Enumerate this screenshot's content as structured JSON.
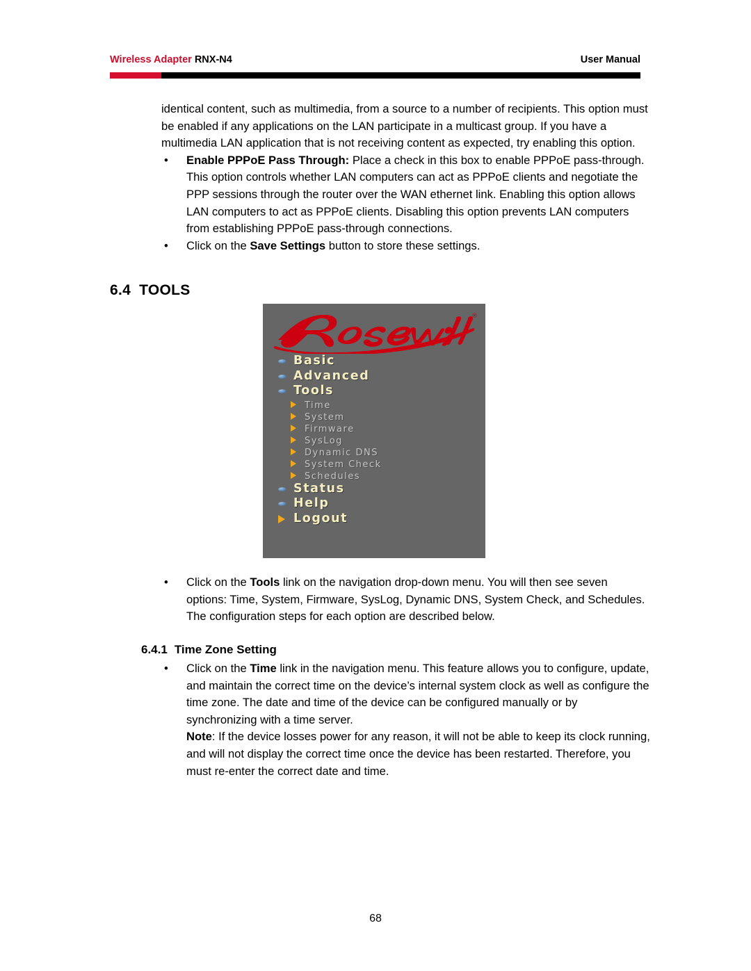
{
  "header": {
    "brand_red": "Wireless Adapter",
    "brand_model": "RNX-N4",
    "right_label": "User Manual",
    "rule_red_color": "#d70f2e",
    "rule_black_color": "#000000"
  },
  "body": {
    "intro_paragraph": "identical content, such as multimedia, from a source to a number of recipients. This option must be enabled if any applications on the LAN participate in a multicast group. If you have a multimedia LAN application that is not receiving content as expected, try enabling this option.",
    "bullet_pppoe": {
      "marker": "•",
      "bold_lead": "Enable PPPoE Pass Through:",
      "text": " Place a check in this box to enable PPPoE pass-through. This option controls whether LAN computers can act as PPPoE clients and negotiate the PPP sessions through the router over the WAN ethernet link. Enabling this option allows LAN computers to act as PPPoE clients. Disabling this option prevents LAN computers from establishing PPPoE pass-through connections."
    },
    "bullet_save": {
      "marker": "•",
      "text_before": "Click on the ",
      "bold_lead": "Save Settings",
      "text_after": " button to store these settings."
    }
  },
  "section": {
    "number": "6.4",
    "title": "TOOLS"
  },
  "router_nav": {
    "logo_text": "Rosewill",
    "logo_trademark": "®",
    "background_color": "#666666",
    "logo_color": "#cc0011",
    "main_label_color": "#f5eec2",
    "sub_label_color": "#c6c6c6",
    "arrow_color": "#f0a81e",
    "items": [
      {
        "label": "Basic",
        "level": "main",
        "marker": "dot"
      },
      {
        "label": "Advanced",
        "level": "main",
        "marker": "dot"
      },
      {
        "label": "Tools",
        "level": "main",
        "marker": "dot"
      },
      {
        "label": "Time",
        "level": "sub",
        "marker": "triangle"
      },
      {
        "label": "System",
        "level": "sub",
        "marker": "triangle"
      },
      {
        "label": "Firmware",
        "level": "sub",
        "marker": "triangle"
      },
      {
        "label": "SysLog",
        "level": "sub",
        "marker": "triangle"
      },
      {
        "label": "Dynamic DNS",
        "level": "sub",
        "marker": "triangle"
      },
      {
        "label": "System Check",
        "level": "sub",
        "marker": "triangle"
      },
      {
        "label": "Schedules",
        "level": "sub",
        "marker": "triangle"
      },
      {
        "label": "Status",
        "level": "main",
        "marker": "dot"
      },
      {
        "label": "Help",
        "level": "main",
        "marker": "dot"
      },
      {
        "label": "Logout",
        "level": "main",
        "marker": "triangle"
      }
    ]
  },
  "after_image": {
    "bullet_tools": {
      "marker": "•",
      "text_before": "Click on the ",
      "bold_lead": "Tools",
      "text_after": " link on the navigation drop-down menu. You will then see seven options: Time, System, Firmware, SysLog, Dynamic DNS, System Check, and Schedules. The configuration steps for each option are described below."
    }
  },
  "subsection": {
    "number": "6.4.1",
    "title": "Time Zone Setting"
  },
  "time_zone": {
    "bullet_time": {
      "marker": "•",
      "text_before": "Click on the ",
      "bold_lead": "Time",
      "text_after": " link in the navigation menu. This feature allows you to configure, update, and maintain the correct time on the device’s internal system clock as well as configure the time zone. The date and time of the device can be configured manually or by synchronizing with a time server."
    },
    "note": {
      "bold_lead": "Note",
      "text": ": If the device losses power for any reason, it will not be able to keep its clock running, and will not display the correct time once the device has been restarted. Therefore, you must re-enter the correct date and time."
    }
  },
  "footer": {
    "page_number": "68"
  }
}
